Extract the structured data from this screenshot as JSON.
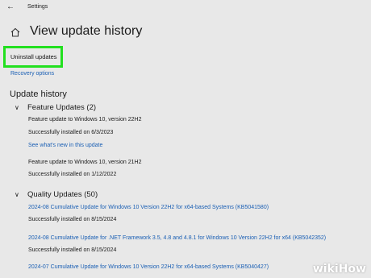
{
  "window": {
    "title": "Settings"
  },
  "header": {
    "title": "View update history"
  },
  "actions": {
    "uninstall_label": "Uninstall updates",
    "recovery_label": "Recovery options"
  },
  "history": {
    "title": "Update history",
    "feature": {
      "header": "Feature Updates (2)",
      "items": [
        {
          "name": "Feature update to Windows 10, version 22H2",
          "status": "Successfully installed on 6/3/2023",
          "link": "See what's new in this update"
        },
        {
          "name": "Feature update to Windows 10, version 21H2",
          "status": "Successfully installed on 1/12/2022"
        }
      ]
    },
    "quality": {
      "header": "Quality Updates (50)",
      "items": [
        {
          "name": "2024-08 Cumulative Update for Windows 10 Version 22H2 for x64-based Systems (KB5041580)",
          "status": "Successfully installed on 8/15/2024"
        },
        {
          "name": "2024-08 Cumulative Update for .NET Framework 3.5, 4.8 and 4.8.1 for Windows 10 Version 22H2 for x64 (KB5042352)",
          "status": "Successfully installed on 8/15/2024"
        },
        {
          "name": "2024-07 Cumulative Update for Windows 10 Version 22H2 for x64-based Systems (KB5040427)"
        }
      ]
    }
  },
  "watermark": {
    "part1": "wiki",
    "part2": "How"
  },
  "colors": {
    "accent_link": "#1a5fb4",
    "highlight": "#22e01f",
    "background": "#e8e8e8"
  }
}
